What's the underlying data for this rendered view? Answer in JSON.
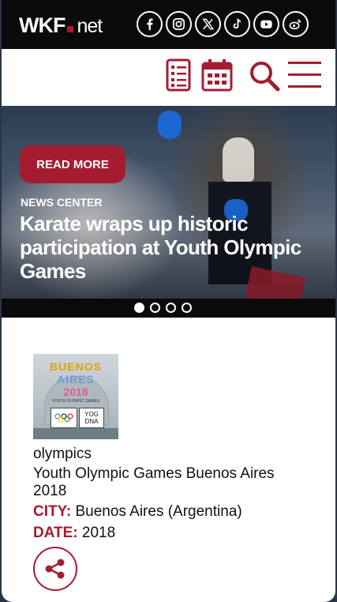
{
  "header": {
    "logo": {
      "brand": "WKF",
      "suffix": "net"
    },
    "socials": [
      "facebook-icon",
      "instagram-icon",
      "x-icon",
      "tiktok-icon",
      "youtube-icon",
      "weibo-icon"
    ]
  },
  "nav": {
    "icons": [
      "list-icon",
      "calendar-icon",
      "search-icon",
      "hamburger-menu-icon"
    ]
  },
  "hero": {
    "button_label": "READ MORE",
    "eyebrow": "NEWS CENTER",
    "headline": "Karate wraps up historic participation at Youth Olympic Games",
    "slides_total": 4,
    "active_slide": 1
  },
  "event": {
    "thumb": {
      "line1": "BUENOS",
      "line2": "AIRES",
      "line3": "2018",
      "sub": "YOUTH OLYMPIC GAMES",
      "badge": "YOG DNA"
    },
    "tag": "olympics",
    "title": "Youth Olympic Games Buenos Aires 2018",
    "city_label": "CITY:",
    "city_value": "Buenos Aires (Argentina)",
    "date_label": "DATE:",
    "date_value": "2018",
    "share_icon": "share-icon"
  },
  "colors": {
    "brand_red": "#a51c30",
    "topbar": "#0a0a0a",
    "outer_bg": "#2b3448"
  }
}
